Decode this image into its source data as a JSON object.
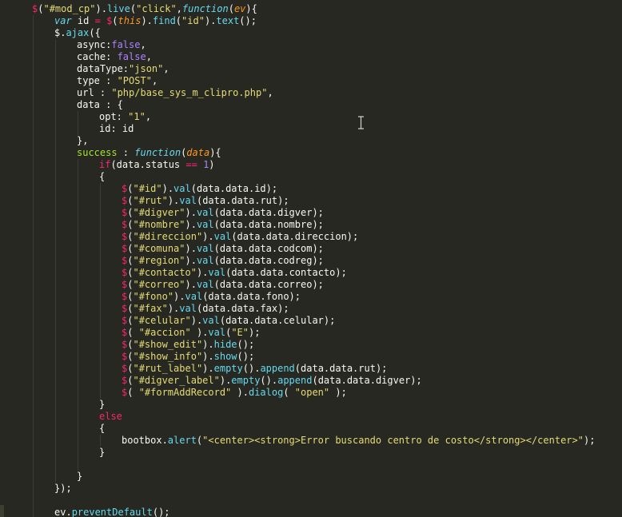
{
  "editor": {
    "language": "javascript",
    "theme_colors": {
      "background": "#272822",
      "foreground": "#f8f8f2",
      "keyword": "#f92672",
      "string": "#e6db74",
      "number": "#ae81ff",
      "function": "#66d9ef",
      "parameter": "#fd971f",
      "property": "#a6e22e"
    },
    "cursor_icon": "ibeam-icon",
    "lines": [
      {
        "indent": 4,
        "tokens": [
          [
            "dollar",
            "$"
          ],
          [
            "plain",
            "("
          ],
          [
            "str",
            "\"#mod_cp\""
          ],
          [
            "plain",
            ")."
          ],
          [
            "func",
            "live"
          ],
          [
            "plain",
            "("
          ],
          [
            "str",
            "\"click\""
          ],
          [
            "plain",
            ","
          ],
          [
            "stor",
            "function"
          ],
          [
            "plain",
            "("
          ],
          [
            "param",
            "ev"
          ],
          [
            "plain",
            "){"
          ]
        ]
      },
      {
        "indent": 8,
        "tokens": [
          [
            "stor",
            "var"
          ],
          [
            "plain",
            " id "
          ],
          [
            "kw",
            "="
          ],
          [
            "plain",
            " "
          ],
          [
            "dollar",
            "$"
          ],
          [
            "plain",
            "("
          ],
          [
            "lang",
            "this"
          ],
          [
            "plain",
            ")."
          ],
          [
            "func",
            "find"
          ],
          [
            "plain",
            "("
          ],
          [
            "str",
            "\"id\""
          ],
          [
            "plain",
            ")."
          ],
          [
            "func",
            "text"
          ],
          [
            "plain",
            "();"
          ]
        ]
      },
      {
        "indent": 8,
        "tokens": [
          [
            "plain",
            "$."
          ],
          [
            "func",
            "ajax"
          ],
          [
            "plain",
            "({"
          ]
        ]
      },
      {
        "indent": 12,
        "tokens": [
          [
            "plain",
            "async:"
          ],
          [
            "num",
            "false"
          ],
          [
            "plain",
            ","
          ]
        ]
      },
      {
        "indent": 12,
        "tokens": [
          [
            "plain",
            "cache: "
          ],
          [
            "num",
            "false"
          ],
          [
            "plain",
            ","
          ]
        ]
      },
      {
        "indent": 12,
        "tokens": [
          [
            "plain",
            "dataType:"
          ],
          [
            "str",
            "\"json\""
          ],
          [
            "plain",
            ","
          ]
        ]
      },
      {
        "indent": 12,
        "tokens": [
          [
            "plain",
            "type : "
          ],
          [
            "str",
            "\"POST\""
          ],
          [
            "plain",
            ","
          ]
        ]
      },
      {
        "indent": 12,
        "tokens": [
          [
            "plain",
            "url : "
          ],
          [
            "str",
            "\"php/base_sys_m_clipro.php\""
          ],
          [
            "plain",
            ","
          ]
        ]
      },
      {
        "indent": 12,
        "tokens": [
          [
            "plain",
            "data : {"
          ]
        ]
      },
      {
        "indent": 16,
        "tokens": [
          [
            "plain",
            "opt: "
          ],
          [
            "str",
            "\"1\""
          ],
          [
            "plain",
            ","
          ]
        ]
      },
      {
        "indent": 16,
        "tokens": [
          [
            "plain",
            "id: id"
          ]
        ]
      },
      {
        "indent": 12,
        "tokens": [
          [
            "plain",
            "},"
          ]
        ]
      },
      {
        "indent": 12,
        "tokens": [
          [
            "prop",
            "success"
          ],
          [
            "plain",
            " : "
          ],
          [
            "stor",
            "function"
          ],
          [
            "plain",
            "("
          ],
          [
            "param",
            "data"
          ],
          [
            "plain",
            "){"
          ]
        ]
      },
      {
        "indent": 16,
        "tokens": [
          [
            "kw",
            "if"
          ],
          [
            "plain",
            "(data.status "
          ],
          [
            "kw",
            "=="
          ],
          [
            "plain",
            " "
          ],
          [
            "num",
            "1"
          ],
          [
            "plain",
            ")"
          ]
        ]
      },
      {
        "indent": 16,
        "tokens": [
          [
            "plain",
            "{"
          ]
        ]
      },
      {
        "indent": 20,
        "tokens": [
          [
            "dollar",
            "$"
          ],
          [
            "plain",
            "("
          ],
          [
            "str",
            "\"#id\""
          ],
          [
            "plain",
            ")."
          ],
          [
            "func",
            "val"
          ],
          [
            "plain",
            "(data.data.id);"
          ]
        ]
      },
      {
        "indent": 20,
        "tokens": [
          [
            "dollar",
            "$"
          ],
          [
            "plain",
            "("
          ],
          [
            "str",
            "\"#rut\""
          ],
          [
            "plain",
            ")."
          ],
          [
            "func",
            "val"
          ],
          [
            "plain",
            "(data.data.rut);"
          ]
        ]
      },
      {
        "indent": 20,
        "tokens": [
          [
            "dollar",
            "$"
          ],
          [
            "plain",
            "("
          ],
          [
            "str",
            "\"#digver\""
          ],
          [
            "plain",
            ")."
          ],
          [
            "func",
            "val"
          ],
          [
            "plain",
            "(data.data.digver);"
          ]
        ]
      },
      {
        "indent": 20,
        "tokens": [
          [
            "dollar",
            "$"
          ],
          [
            "plain",
            "("
          ],
          [
            "str",
            "\"#nombre\""
          ],
          [
            "plain",
            ")."
          ],
          [
            "func",
            "val"
          ],
          [
            "plain",
            "(data.data.nombre);"
          ]
        ]
      },
      {
        "indent": 20,
        "tokens": [
          [
            "dollar",
            "$"
          ],
          [
            "plain",
            "("
          ],
          [
            "str",
            "\"#direccion\""
          ],
          [
            "plain",
            ")."
          ],
          [
            "func",
            "val"
          ],
          [
            "plain",
            "(data.data.direccion);"
          ]
        ]
      },
      {
        "indent": 20,
        "tokens": [
          [
            "dollar",
            "$"
          ],
          [
            "plain",
            "("
          ],
          [
            "str",
            "\"#comuna\""
          ],
          [
            "plain",
            ")."
          ],
          [
            "func",
            "val"
          ],
          [
            "plain",
            "(data.data.codcom);"
          ]
        ]
      },
      {
        "indent": 20,
        "tokens": [
          [
            "dollar",
            "$"
          ],
          [
            "plain",
            "("
          ],
          [
            "str",
            "\"#region\""
          ],
          [
            "plain",
            ")."
          ],
          [
            "func",
            "val"
          ],
          [
            "plain",
            "(data.data.codreg);"
          ]
        ]
      },
      {
        "indent": 20,
        "tokens": [
          [
            "dollar",
            "$"
          ],
          [
            "plain",
            "("
          ],
          [
            "str",
            "\"#contacto\""
          ],
          [
            "plain",
            ")."
          ],
          [
            "func",
            "val"
          ],
          [
            "plain",
            "(data.data.contacto);"
          ]
        ]
      },
      {
        "indent": 20,
        "tokens": [
          [
            "dollar",
            "$"
          ],
          [
            "plain",
            "("
          ],
          [
            "str",
            "\"#correo\""
          ],
          [
            "plain",
            ")."
          ],
          [
            "func",
            "val"
          ],
          [
            "plain",
            "(data.data.correo);"
          ]
        ]
      },
      {
        "indent": 20,
        "tokens": [
          [
            "dollar",
            "$"
          ],
          [
            "plain",
            "("
          ],
          [
            "str",
            "\"#fono\""
          ],
          [
            "plain",
            ")."
          ],
          [
            "func",
            "val"
          ],
          [
            "plain",
            "(data.data.fono);"
          ]
        ]
      },
      {
        "indent": 20,
        "tokens": [
          [
            "dollar",
            "$"
          ],
          [
            "plain",
            "("
          ],
          [
            "str",
            "\"#fax\""
          ],
          [
            "plain",
            ")."
          ],
          [
            "func",
            "val"
          ],
          [
            "plain",
            "(data.data.fax);"
          ]
        ]
      },
      {
        "indent": 20,
        "tokens": [
          [
            "dollar",
            "$"
          ],
          [
            "plain",
            "("
          ],
          [
            "str",
            "\"#celular\""
          ],
          [
            "plain",
            ")."
          ],
          [
            "func",
            "val"
          ],
          [
            "plain",
            "(data.data.celular);"
          ]
        ]
      },
      {
        "indent": 20,
        "tokens": [
          [
            "dollar",
            "$"
          ],
          [
            "plain",
            "( "
          ],
          [
            "str",
            "\"#accion\""
          ],
          [
            "plain",
            " )."
          ],
          [
            "func",
            "val"
          ],
          [
            "plain",
            "("
          ],
          [
            "str",
            "\"E\""
          ],
          [
            "plain",
            ");"
          ]
        ]
      },
      {
        "indent": 20,
        "tokens": [
          [
            "dollar",
            "$"
          ],
          [
            "plain",
            "("
          ],
          [
            "str",
            "\"#show_edit\""
          ],
          [
            "plain",
            ")."
          ],
          [
            "func",
            "hide"
          ],
          [
            "plain",
            "();"
          ]
        ]
      },
      {
        "indent": 20,
        "tokens": [
          [
            "dollar",
            "$"
          ],
          [
            "plain",
            "("
          ],
          [
            "str",
            "\"#show_info\""
          ],
          [
            "plain",
            ")."
          ],
          [
            "func",
            "show"
          ],
          [
            "plain",
            "();"
          ]
        ]
      },
      {
        "indent": 20,
        "tokens": [
          [
            "dollar",
            "$"
          ],
          [
            "plain",
            "("
          ],
          [
            "str",
            "\"#rut_label\""
          ],
          [
            "plain",
            ")."
          ],
          [
            "func",
            "empty"
          ],
          [
            "plain",
            "()."
          ],
          [
            "func",
            "append"
          ],
          [
            "plain",
            "(data.data.rut);"
          ]
        ]
      },
      {
        "indent": 20,
        "tokens": [
          [
            "dollar",
            "$"
          ],
          [
            "plain",
            "("
          ],
          [
            "str",
            "\"#digver_label\""
          ],
          [
            "plain",
            ")."
          ],
          [
            "func",
            "empty"
          ],
          [
            "plain",
            "()."
          ],
          [
            "func",
            "append"
          ],
          [
            "plain",
            "(data.data.digver);"
          ]
        ]
      },
      {
        "indent": 20,
        "tokens": [
          [
            "dollar",
            "$"
          ],
          [
            "plain",
            "( "
          ],
          [
            "str",
            "\"#formAddRecord\""
          ],
          [
            "plain",
            " )."
          ],
          [
            "func",
            "dialog"
          ],
          [
            "plain",
            "( "
          ],
          [
            "str",
            "\"open\""
          ],
          [
            "plain",
            " );"
          ]
        ]
      },
      {
        "indent": 16,
        "tokens": [
          [
            "plain",
            "}"
          ]
        ]
      },
      {
        "indent": 16,
        "tokens": [
          [
            "kw",
            "else"
          ]
        ]
      },
      {
        "indent": 16,
        "tokens": [
          [
            "plain",
            "{"
          ]
        ]
      },
      {
        "indent": 20,
        "tokens": [
          [
            "plain",
            "bootbox."
          ],
          [
            "func",
            "alert"
          ],
          [
            "plain",
            "("
          ],
          [
            "str",
            "\"<center><strong>Error buscando centro de costo</strong></center>\""
          ],
          [
            "plain",
            ");"
          ]
        ]
      },
      {
        "indent": 16,
        "tokens": [
          [
            "plain",
            "}"
          ]
        ]
      },
      {
        "indent": 0,
        "tokens": []
      },
      {
        "indent": 12,
        "tokens": [
          [
            "plain",
            "}"
          ]
        ]
      },
      {
        "indent": 8,
        "tokens": [
          [
            "plain",
            "});"
          ]
        ]
      },
      {
        "indent": 0,
        "tokens": []
      },
      {
        "indent": 8,
        "tokens": [
          [
            "plain",
            "ev."
          ],
          [
            "func",
            "preventDefault"
          ],
          [
            "plain",
            "();"
          ]
        ]
      }
    ]
  }
}
